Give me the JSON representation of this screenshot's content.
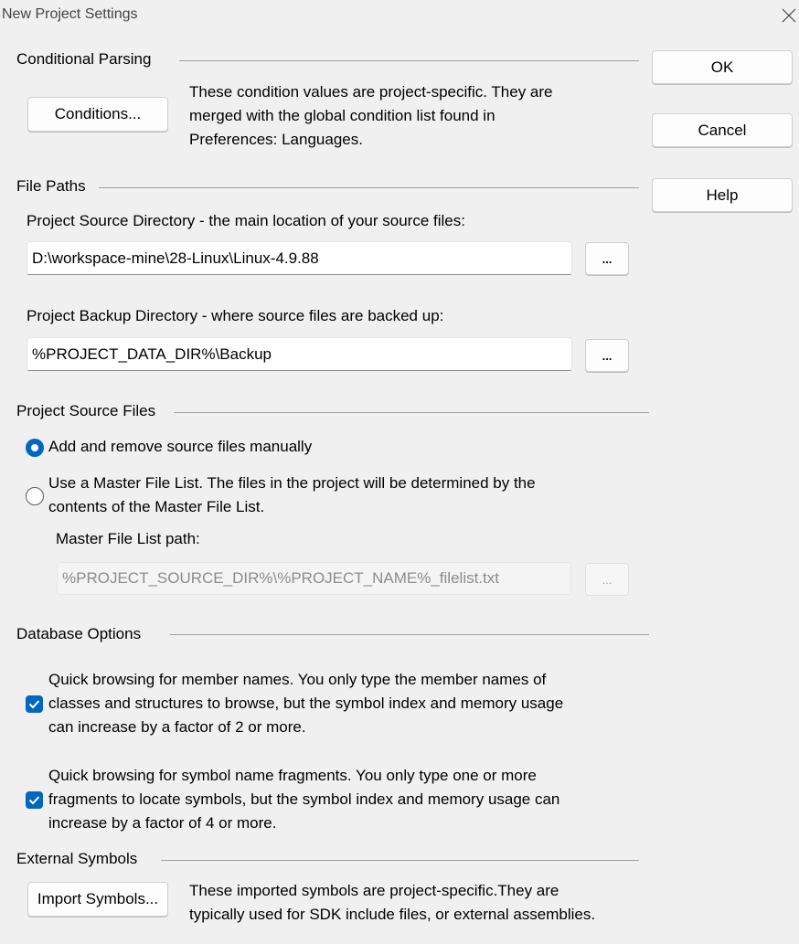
{
  "window": {
    "title": "New Project Settings"
  },
  "buttons": {
    "ok": "OK",
    "cancel": "Cancel",
    "help": "Help"
  },
  "conditional_parsing": {
    "title": "Conditional Parsing",
    "button": "Conditions...",
    "desc_lines": [
      "These condition values are project-specific.  They are",
      "merged with the global condition list found in",
      "Preferences: Languages."
    ]
  },
  "file_paths": {
    "title": "File Paths",
    "source_label": "Project Source Directory - the main location of your source files:",
    "source_value": "D:\\workspace-mine\\28-Linux\\Linux-4.9.88",
    "browse_label": "...",
    "backup_label": "Project Backup Directory - where source files are backed up:",
    "backup_value": "%PROJECT_DATA_DIR%\\Backup"
  },
  "project_source_files": {
    "title": "Project Source Files",
    "option_manual": "Add and remove source files manually",
    "option_master_lines": [
      "Use a Master File List. The files in the project will be determined by the",
      "contents of the Master File List."
    ],
    "selected": "manual",
    "master_path_label": "Master File List path:",
    "master_path_value": "%PROJECT_SOURCE_DIR%\\%PROJECT_NAME%_filelist.txt",
    "browse_label": "..."
  },
  "database_options": {
    "title": "Database Options",
    "member_lines": [
      "Quick browsing for member names.  You only type the member names of",
      "classes and structures to browse, but the symbol index and memory usage",
      "can increase by a factor of 2 or more."
    ],
    "member_checked": true,
    "fragment_lines": [
      "Quick browsing for symbol name fragments.  You only type one or more",
      "fragments to locate symbols, but the symbol index and memory usage can",
      "increase by a factor of 4 or more."
    ],
    "fragment_checked": true
  },
  "external_symbols": {
    "title": "External Symbols",
    "button": "Import Symbols...",
    "desc_lines": [
      "These imported symbols are project-specific.They are",
      "typically used for SDK include files, or external assemblies."
    ]
  },
  "colors": {
    "accent": "#0067c0",
    "background": "#f0f0f0"
  }
}
